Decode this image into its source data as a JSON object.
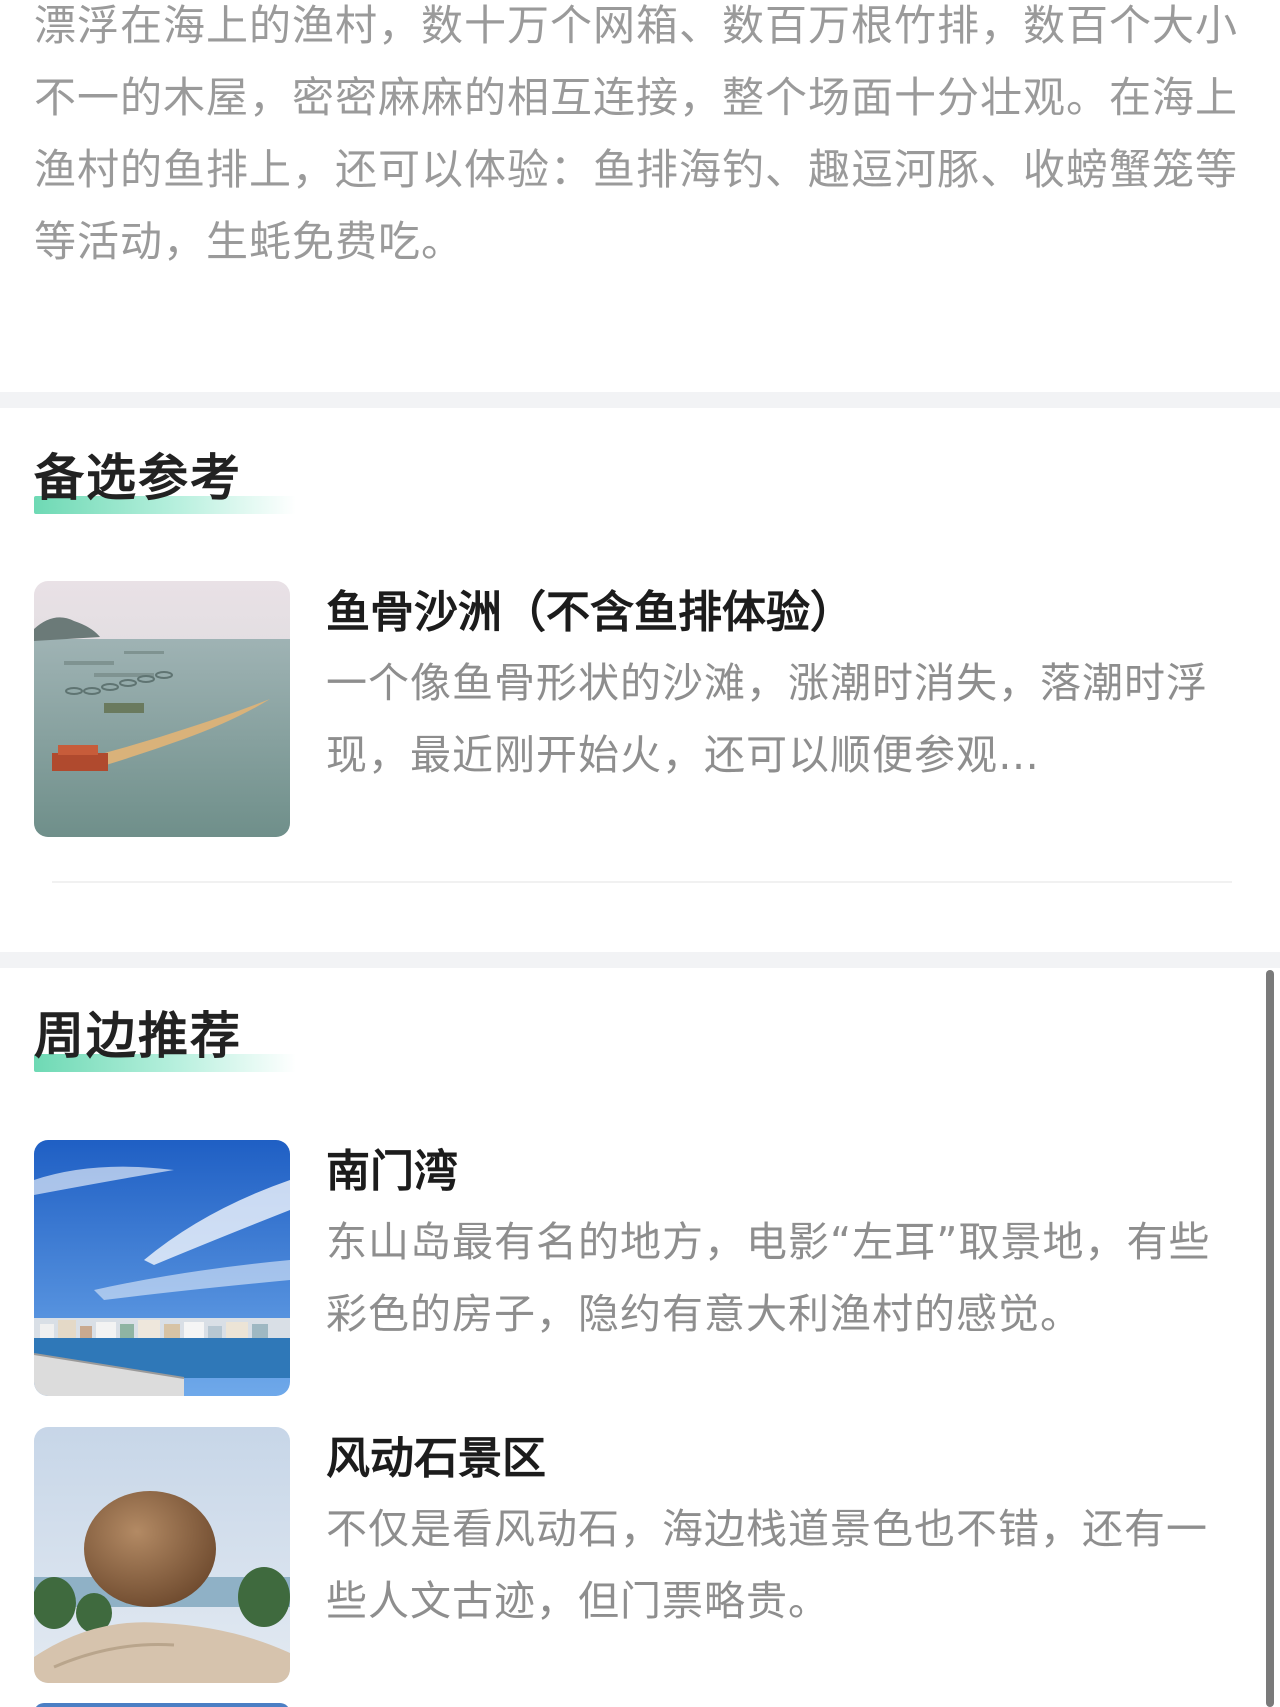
{
  "intro": {
    "text": "漂浮在海上的渔村，数十万个网箱、数百万根竹排，数百个大小不一的木屋，密密麻麻的相互连接，整个场面十分壮观。在海上渔村的鱼排上，还可以体验：鱼排海钓、趣逗河豚、收螃蟹笼等等活动，生蚝免费吃。"
  },
  "alternatives": {
    "title": "备选参考",
    "items": [
      {
        "name": "鱼骨沙洲（不含鱼排体验）",
        "desc": "一个像鱼骨形状的沙滩，涨潮时消失，落潮时浮现，最近刚开始火，还可以顺便参观…"
      }
    ]
  },
  "nearby": {
    "title": "周边推荐",
    "items": [
      {
        "name": "南门湾",
        "desc": "东山岛最有名的地方，电影“左耳”取景地，有些彩色的房子，隐约有意大利渔村的感觉。"
      },
      {
        "name": "风动石景区",
        "desc": "不仅是看风动石，海边栈道景色也不错，还有一些人文古迹，但门票略贵。"
      }
    ]
  },
  "colors": {
    "accent_underline": "#6ed9b4",
    "body_text": "#8e8e8e",
    "title_text": "#1c1c1c",
    "divider": "#f2f3f5"
  }
}
